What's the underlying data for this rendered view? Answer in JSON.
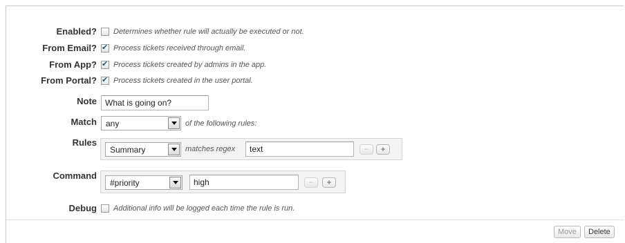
{
  "rows": {
    "enabled": {
      "label": "Enabled?",
      "checked": false,
      "desc": "Determines whether rule will actually be executed or not."
    },
    "from_email": {
      "label": "From Email?",
      "checked": true,
      "desc": "Process tickets received through email."
    },
    "from_app": {
      "label": "From App?",
      "checked": true,
      "desc": "Process tickets created by admins in the app."
    },
    "from_portal": {
      "label": "From Portal?",
      "checked": true,
      "desc": "Process tickets created in the user portal."
    }
  },
  "note": {
    "label": "Note",
    "value": "What is going on?"
  },
  "match": {
    "label": "Match",
    "selected": "any",
    "suffix": "of the following rules:"
  },
  "rules": {
    "label": "Rules",
    "field": "Summary",
    "operator": "matches regex",
    "value": "text",
    "minus": "−",
    "plus": "+"
  },
  "command": {
    "label": "Command",
    "field": "#priority",
    "value": "high",
    "minus": "−",
    "plus": "+"
  },
  "debug": {
    "label": "Debug",
    "checked": false,
    "desc": "Additional info will be logged each time the rule is run."
  },
  "footer": {
    "move_label": "Move",
    "delete_label": "Delete"
  }
}
